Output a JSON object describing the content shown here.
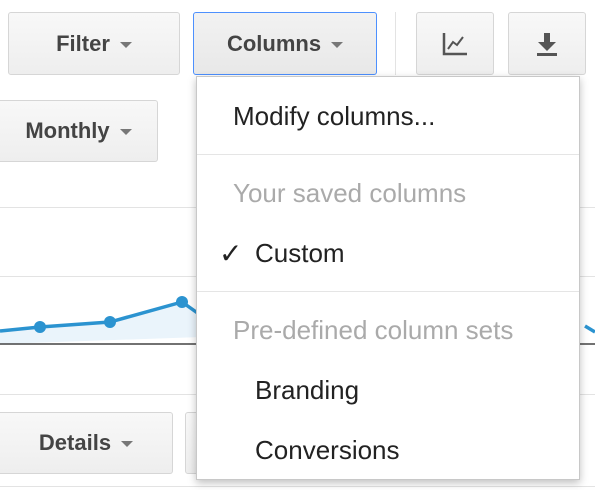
{
  "toolbar": {
    "filter_label": "Filter",
    "columns_label": "Columns",
    "chart_icon": "line-chart-icon",
    "download_icon": "download-icon"
  },
  "period": {
    "selected": "Monthly"
  },
  "bottom": {
    "details_label": "Details"
  },
  "columns_menu": {
    "modify": "Modify columns...",
    "saved_header": "Your saved columns",
    "saved_items": [
      {
        "label": "Custom",
        "checked": true
      }
    ],
    "predefined_header": "Pre-defined column sets",
    "predefined_items": [
      {
        "label": "Branding"
      },
      {
        "label": "Conversions"
      }
    ]
  },
  "colors": {
    "series_line": "#2b93d0",
    "series_fill": "#eaf4fb",
    "focus_border": "#4d90fe"
  }
}
